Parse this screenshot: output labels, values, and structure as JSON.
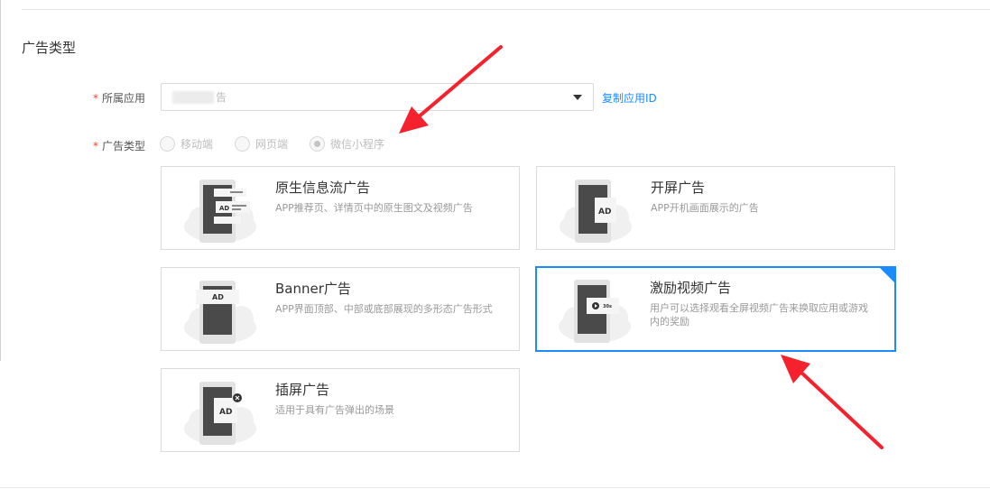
{
  "section": {
    "title": "广告类型"
  },
  "form": {
    "app_label": "所属应用",
    "app_value_suffix": "告",
    "copy_link": "复制应用ID",
    "type_label": "广告类型",
    "required_mark": "*",
    "radios": [
      {
        "label": "移动端",
        "selected": false
      },
      {
        "label": "网页端",
        "selected": false
      },
      {
        "label": "微信小程序",
        "selected": true
      }
    ]
  },
  "cards": [
    {
      "title": "原生信息流广告",
      "desc": "APP推荐页、详情页中的原生图文及视频广告",
      "badge": "AD",
      "selected": false
    },
    {
      "title": "开屏广告",
      "desc": "APP开机画面展示的广告",
      "badge": "AD",
      "selected": false
    },
    {
      "title": "Banner广告",
      "desc": "APP界面顶部、中部或底部展现的多形态广告形式",
      "badge": "AD",
      "selected": false
    },
    {
      "title": "激励视频广告",
      "desc": "用户可以选择观看全屏视频广告来换取应用或游戏内的奖励",
      "badge": "30s",
      "selected": true
    },
    {
      "title": "插屏广告",
      "desc": "适用于具有广告弹出的场景",
      "badge": "AD",
      "selected": false
    }
  ],
  "colors": {
    "accent": "#1a8cff",
    "required": "#f04134",
    "annotation_arrow": "#f5222d"
  }
}
